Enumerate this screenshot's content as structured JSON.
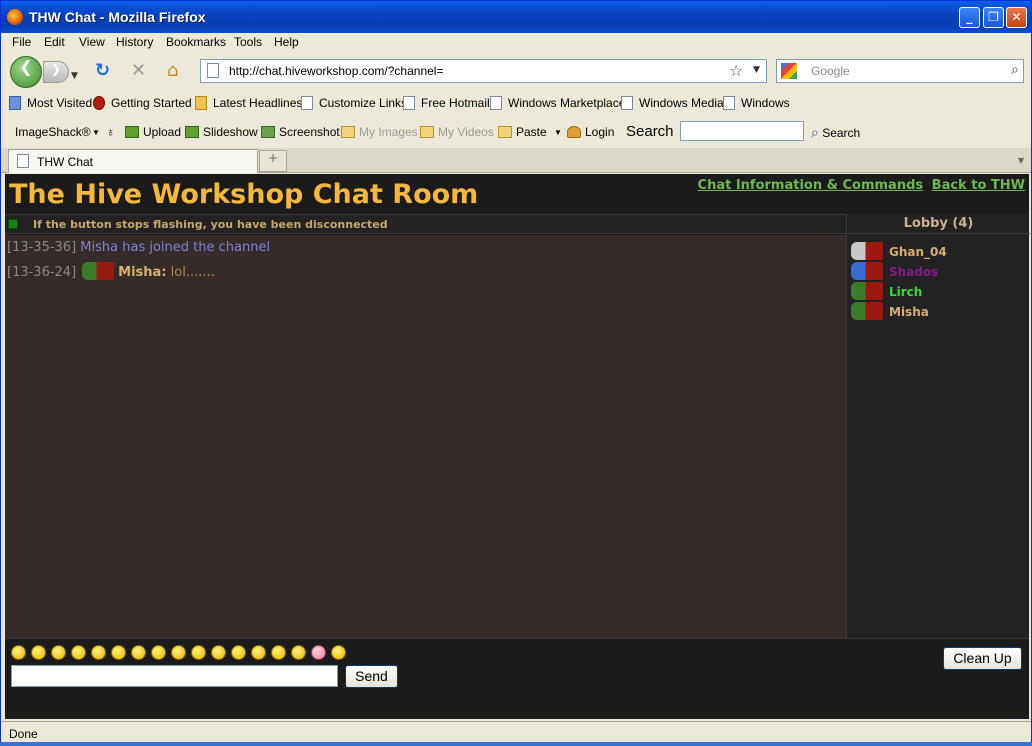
{
  "window": {
    "title": "THW Chat - Mozilla Firefox"
  },
  "menu": [
    "File",
    "Edit",
    "View",
    "History",
    "Bookmarks",
    "Tools",
    "Help"
  ],
  "nav": {
    "url": "http://chat.hiveworkshop.com/?channel=",
    "search_placeholder": "Google"
  },
  "bookmarks": [
    "Most Visited",
    "Getting Started",
    "Latest Headlines",
    "Customize Links",
    "Free Hotmail",
    "Windows Marketplace",
    "Windows Media",
    "Windows"
  ],
  "imageshack": {
    "brand": "ImageShack®",
    "upload": "Upload",
    "slideshow": "Slideshow",
    "screenshot": "Screenshot",
    "my_images": "My Images",
    "my_videos": "My Videos",
    "paste": "Paste",
    "login": "Login",
    "search_label": "Search",
    "search_button": "Search"
  },
  "tabs": [
    {
      "label": "THW Chat"
    }
  ],
  "chat": {
    "title": "The Hive Workshop Chat Room",
    "links": [
      "Chat Information & Commands",
      "Back to THW"
    ],
    "status": "If the button stops flashing, you have been disconnected",
    "messages": [
      {
        "time": "[13-35-36]",
        "text": "Misha has joined the channel",
        "kind": "system"
      },
      {
        "time": "[13-36-24]",
        "nick": "Misha:",
        "text": "lol.......",
        "kind": "user"
      }
    ],
    "lobby": "Lobby (4)",
    "users": [
      {
        "name": "Ghan_04",
        "color": "#d8b070"
      },
      {
        "name": "Shados",
        "color": "#8a1a8a"
      },
      {
        "name": "Lirch",
        "color": "#3ad83a"
      },
      {
        "name": "Misha",
        "color": "#d8b070"
      }
    ],
    "send": "Send",
    "clean_up": "Clean Up"
  },
  "statusbar": {
    "text": "Done"
  }
}
